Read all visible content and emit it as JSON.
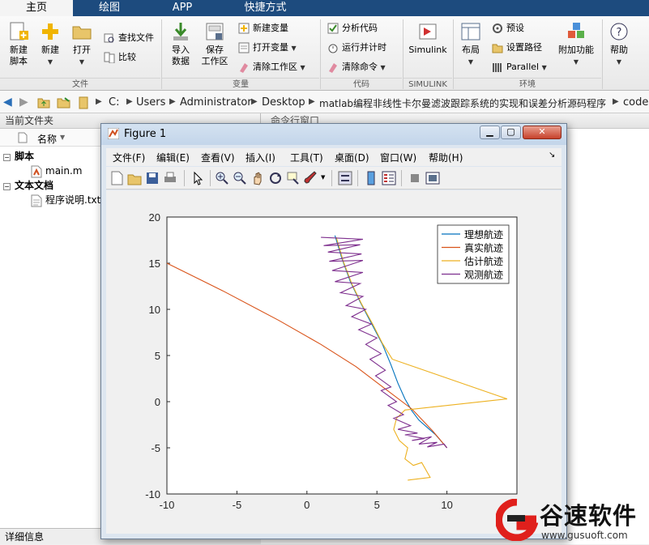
{
  "tabs": [
    {
      "label": "主页"
    },
    {
      "label": "绘图"
    },
    {
      "label": "APP"
    },
    {
      "label": "快捷方式"
    }
  ],
  "ribbon": {
    "new_script": "新建\n脚本",
    "new": "新建",
    "open": "打开",
    "find_files": "查找文件",
    "compare": "比较",
    "import_data": "导入\n数据",
    "save_workspace": "保存\n工作区",
    "new_variable": "新建变量",
    "open_variable": "打开变量",
    "clear_workspace": "清除工作区",
    "analyze_code": "分析代码",
    "run_and_time": "运行并计时",
    "clear_commands": "清除命令",
    "simulink": "Simulink",
    "layout": "布局",
    "preferences": "预设",
    "set_path": "设置路径",
    "parallel": "Parallel",
    "addons": "附加功能",
    "help": "帮助",
    "sections": {
      "file": "文件",
      "variable": "变量",
      "code": "代码",
      "simulink": "SIMULINK",
      "environment": "环境"
    }
  },
  "address": {
    "path": [
      "C:",
      "Users",
      "Administrator",
      "Desktop",
      "matlab编程非线性卡尔曼滤波跟踪系统的实现和误差分析源码程序",
      "code"
    ]
  },
  "file_panel": {
    "title": "当前文件夹",
    "column_name": "名称",
    "groups": [
      {
        "label": "脚本",
        "items": [
          "main.m"
        ]
      },
      {
        "label": "文本文档",
        "items": [
          "程序说明.txt"
        ]
      }
    ],
    "details": "详细信息"
  },
  "command_window": {
    "title": "命令行窗口"
  },
  "figure": {
    "title": "Figure 1",
    "menu": [
      "文件(F)",
      "编辑(E)",
      "查看(V)",
      "插入(I)",
      "工具(T)",
      "桌面(D)",
      "窗口(W)",
      "帮助(H)"
    ]
  },
  "colors": {
    "ideal": "#0072bd",
    "actual": "#d95319",
    "estimated": "#edb120",
    "observed": "#7e2f8e",
    "tabbar": "#1d4b7e"
  },
  "chart_data": {
    "type": "line",
    "title": "",
    "xlabel": "",
    "ylabel": "",
    "xlim": [
      -10,
      15
    ],
    "ylim": [
      -10,
      20
    ],
    "xticks": [
      -10,
      -5,
      0,
      5,
      10
    ],
    "yticks": [
      -10,
      -5,
      0,
      5,
      10,
      15,
      20
    ],
    "legend_position": "top-right",
    "series": [
      {
        "name": "理想航迹",
        "color": "#0072bd",
        "x": [
          2.0,
          2.5,
          3.1,
          3.8,
          4.6,
          5.4,
          6.0,
          6.5,
          7.0,
          7.5,
          8.0,
          8.6,
          9.2,
          9.6,
          10.0
        ],
        "y": [
          18.0,
          15.5,
          13.0,
          10.8,
          8.5,
          6.2,
          4.0,
          2.0,
          0.3,
          -1.0,
          -2.0,
          -2.8,
          -3.6,
          -4.3,
          -5.0
        ]
      },
      {
        "name": "真实航迹",
        "color": "#d95319",
        "x": [
          -10.0,
          -6.0,
          -2.0,
          1.0,
          3.5,
          5.5,
          7.5,
          9.0,
          10.0
        ],
        "y": [
          15.0,
          12.0,
          8.8,
          6.2,
          3.8,
          1.5,
          -0.8,
          -3.2,
          -5.0
        ]
      },
      {
        "name": "估计航迹",
        "color": "#edb120",
        "x": [
          2.1,
          2.6,
          3.2,
          3.9,
          4.7,
          5.4,
          6.1,
          14.3,
          7.0,
          6.4,
          6.2,
          6.6,
          7.2,
          7.0,
          7.6,
          8.2,
          8.8,
          7.2
        ],
        "y": [
          17.8,
          15.2,
          12.8,
          10.6,
          8.4,
          6.3,
          4.6,
          0.3,
          -0.9,
          -1.8,
          -3.0,
          -4.2,
          -5.0,
          -6.2,
          -6.9,
          -6.6,
          -8.2,
          -8.5
        ]
      },
      {
        "name": "观测航迹",
        "color": "#7e2f8e",
        "x": [
          1.0,
          4.0,
          1.2,
          3.8,
          1.5,
          3.9,
          1.6,
          4.0,
          1.8,
          4.0,
          2.0,
          3.8,
          2.4,
          4.0,
          2.8,
          4.2,
          3.2,
          4.6,
          3.7,
          5.0,
          4.2,
          5.3,
          4.5,
          5.6,
          4.9,
          6.0,
          5.3,
          6.4,
          5.8,
          6.9,
          6.2,
          7.4,
          6.5,
          7.9,
          7.0,
          8.4,
          7.5,
          8.9,
          8.0,
          9.3,
          8.6,
          9.8,
          10.0
        ],
        "y": [
          17.8,
          17.6,
          16.9,
          17.0,
          16.2,
          16.0,
          15.2,
          15.3,
          14.2,
          14.0,
          13.0,
          12.8,
          11.8,
          11.4,
          10.4,
          10.0,
          9.2,
          8.4,
          7.8,
          6.9,
          6.2,
          5.2,
          4.6,
          3.4,
          2.8,
          1.6,
          1.2,
          0.0,
          -0.4,
          -1.4,
          -1.8,
          -2.6,
          -3.0,
          -3.4,
          -3.6,
          -4.0,
          -4.2,
          -3.8,
          -4.6,
          -4.4,
          -4.9,
          -4.6,
          -5.0
        ]
      }
    ]
  },
  "watermark": {
    "brand": "谷速软件",
    "url": "www.gusuoft.com"
  }
}
